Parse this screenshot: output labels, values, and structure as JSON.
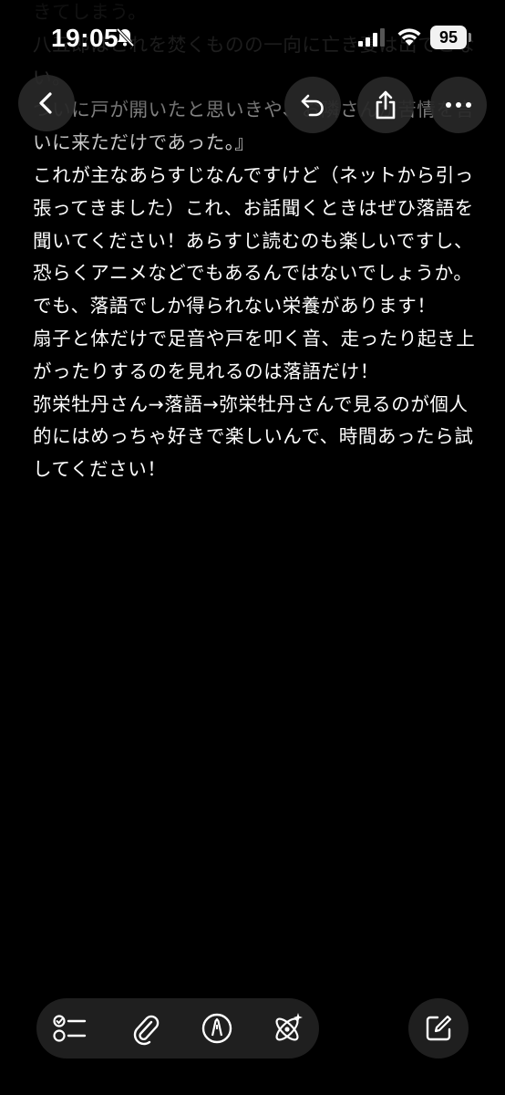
{
  "status": {
    "time": "19:05",
    "battery": "95"
  },
  "note": {
    "body": "きてしまう。\n八五郎はこれを焚くものの一向に亡き妻は出てこない。\nついに戸が開いたと思いきや、お隣さんが苦情を言いに来ただけであった。』\nこれが主なあらすじなんですけど（ネットから引っ張ってきました）これ、お話聞くときはぜひ落語を聞いてください！あらすじ読むのも楽しいですし、恐らくアニメなどでもあるんではないでしょうか。でも、落語でしか得られない栄養があります！\n扇子と体だけで足音や戸を叩く音、走ったり起き上がったりするのを見れるのは落語だけ！\n弥栄牡丹さん→落語→弥栄牡丹さんで見るのが個人的にはめっちゃ好きで楽しいんで、時間あったら試してください！"
  },
  "icons": {
    "back": "chevron-left-icon",
    "undo": "undo-icon",
    "share": "share-icon",
    "more": "more-icon",
    "checklist": "checklist-icon",
    "attach": "paperclip-icon",
    "markup": "pen-circle-icon",
    "ai": "sparkle-atom-icon",
    "compose": "compose-icon"
  },
  "colors": {
    "background": "#000000",
    "button": "#282828",
    "text": "#ffffff"
  }
}
